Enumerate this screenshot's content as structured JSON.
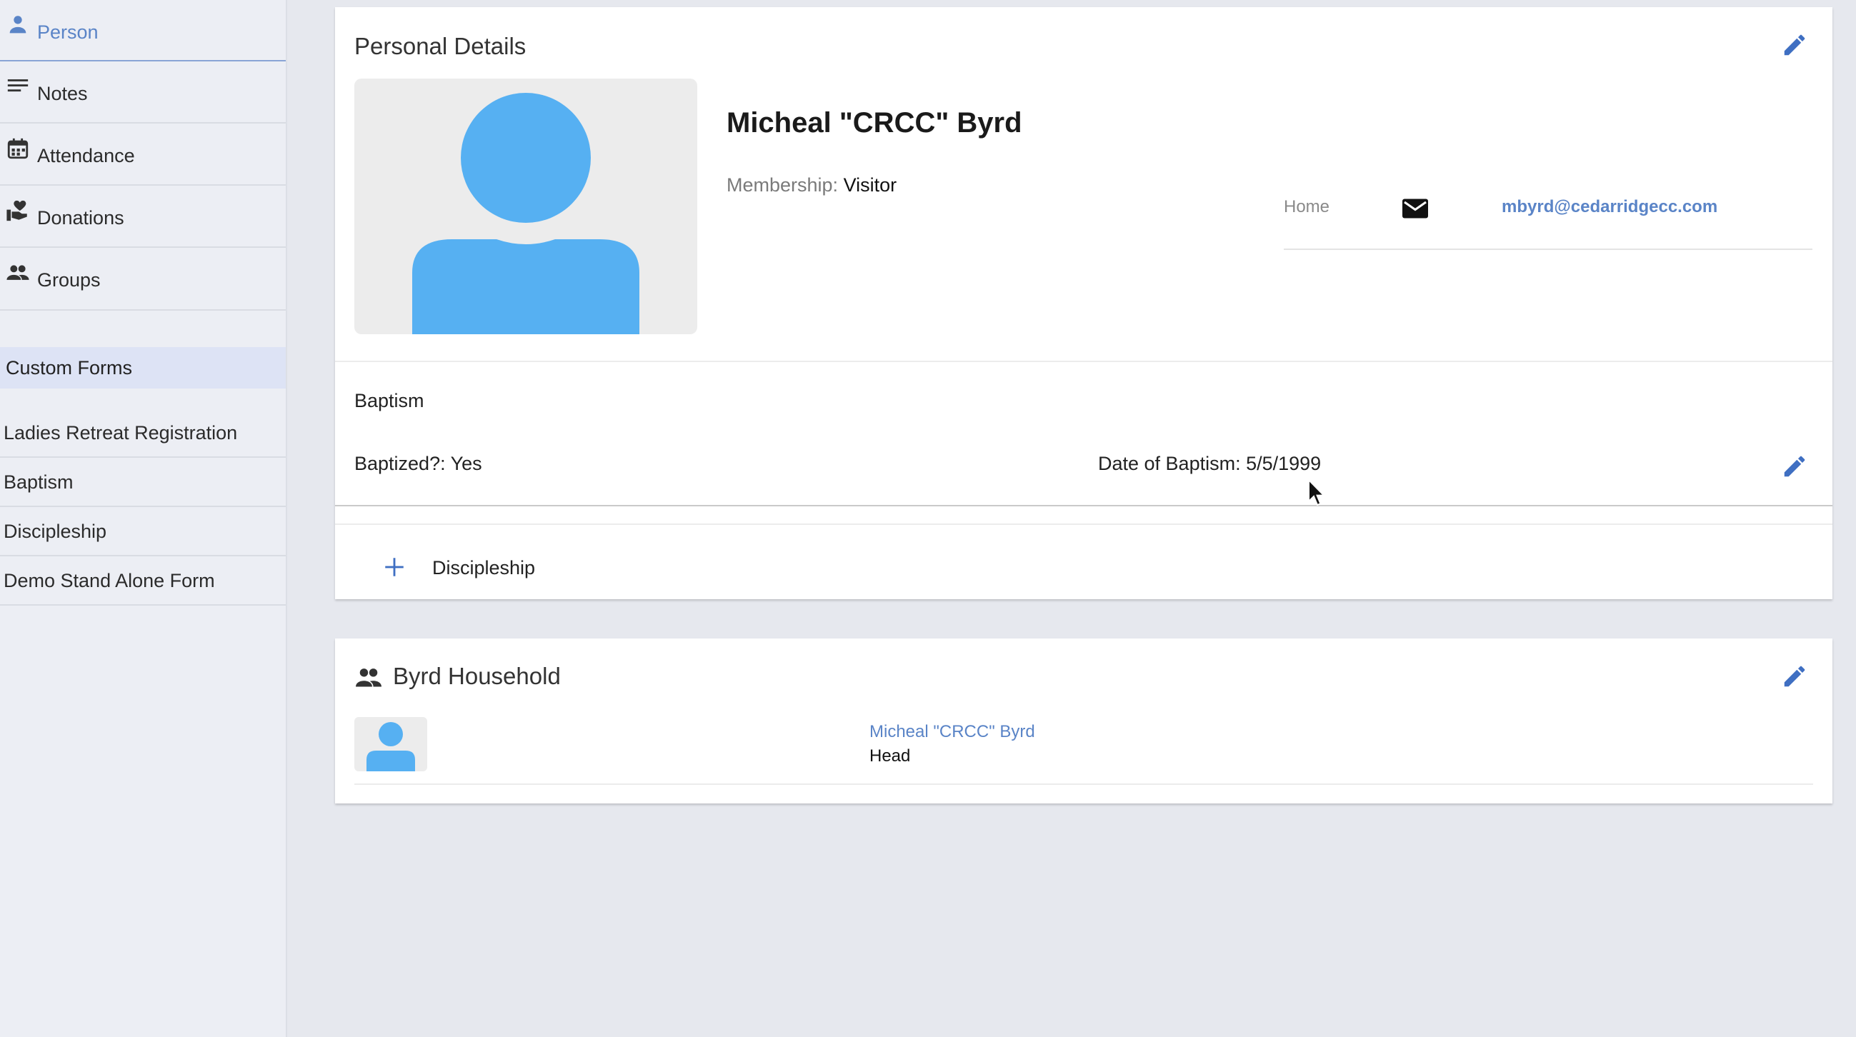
{
  "sidebar": {
    "nav": [
      {
        "label": "Person",
        "icon": "person-icon",
        "active": true
      },
      {
        "label": "Notes",
        "icon": "notes-icon",
        "active": false
      },
      {
        "label": "Attendance",
        "icon": "calendar-icon",
        "active": false
      },
      {
        "label": "Donations",
        "icon": "donation-icon",
        "active": false
      },
      {
        "label": "Groups",
        "icon": "groups-icon",
        "active": false
      }
    ],
    "custom_forms_header": "Custom Forms",
    "forms": [
      {
        "label": "Ladies Retreat Registration"
      },
      {
        "label": "Baptism"
      },
      {
        "label": "Discipleship"
      },
      {
        "label": "Demo Stand Alone Form"
      }
    ]
  },
  "personal_details": {
    "title": "Personal Details",
    "name": "Micheal \"CRCC\" Byrd",
    "membership_label": "Membership:",
    "membership_value": "Visitor",
    "contact": {
      "type": "Home",
      "icon": "mail-icon",
      "email": "mbyrd@cedarridgecc.com"
    },
    "baptism": {
      "title": "Baptism",
      "baptized": "Baptized?: Yes",
      "date": "Date of Baptism: 5/5/1999"
    },
    "discipleship": {
      "label": "Discipleship"
    }
  },
  "household": {
    "title": "Byrd Household",
    "members": [
      {
        "name": "Micheal \"CRCC\" Byrd",
        "role": "Head"
      }
    ]
  },
  "colors": {
    "accent": "#3f6fc2",
    "link": "#5a84c7",
    "avatar": "#56b0f2",
    "background": "#e6e8ee"
  }
}
